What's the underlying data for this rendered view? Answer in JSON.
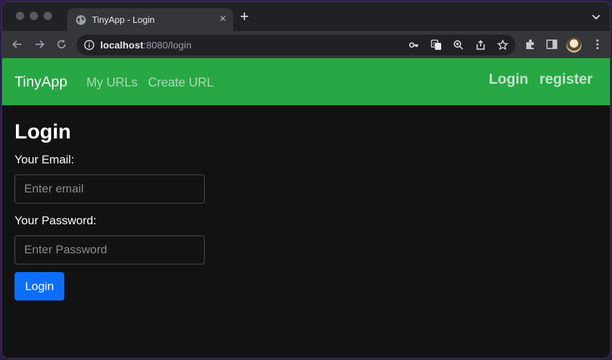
{
  "browser": {
    "tab_title": "TinyApp - Login",
    "tab_close": "×",
    "new_tab": "+",
    "url_host": "localhost",
    "url_path": ":8080/login"
  },
  "navbar": {
    "brand": "TinyApp",
    "links": [
      "My URLs",
      "Create URL"
    ],
    "login": "Login",
    "register": "register",
    "color": "#28a745"
  },
  "form": {
    "title": "Login",
    "email_label": "Your Email:",
    "email_placeholder": "Enter email",
    "password_label": "Your Password:",
    "password_placeholder": "Enter Password",
    "submit_label": "Login",
    "submit_color": "#0d6efd"
  },
  "icons": {
    "favicon": "globe-icon",
    "back": "back-arrow-icon",
    "forward": "forward-arrow-icon",
    "reload": "reload-icon",
    "site_info": "info-icon",
    "password": "key-icon",
    "translate": "translate-icon",
    "zoom": "zoom-icon",
    "share": "share-icon",
    "bookmark": "star-icon",
    "extensions": "puzzle-icon",
    "side_panel": "side-panel-icon",
    "menu": "kebab-menu-icon"
  }
}
